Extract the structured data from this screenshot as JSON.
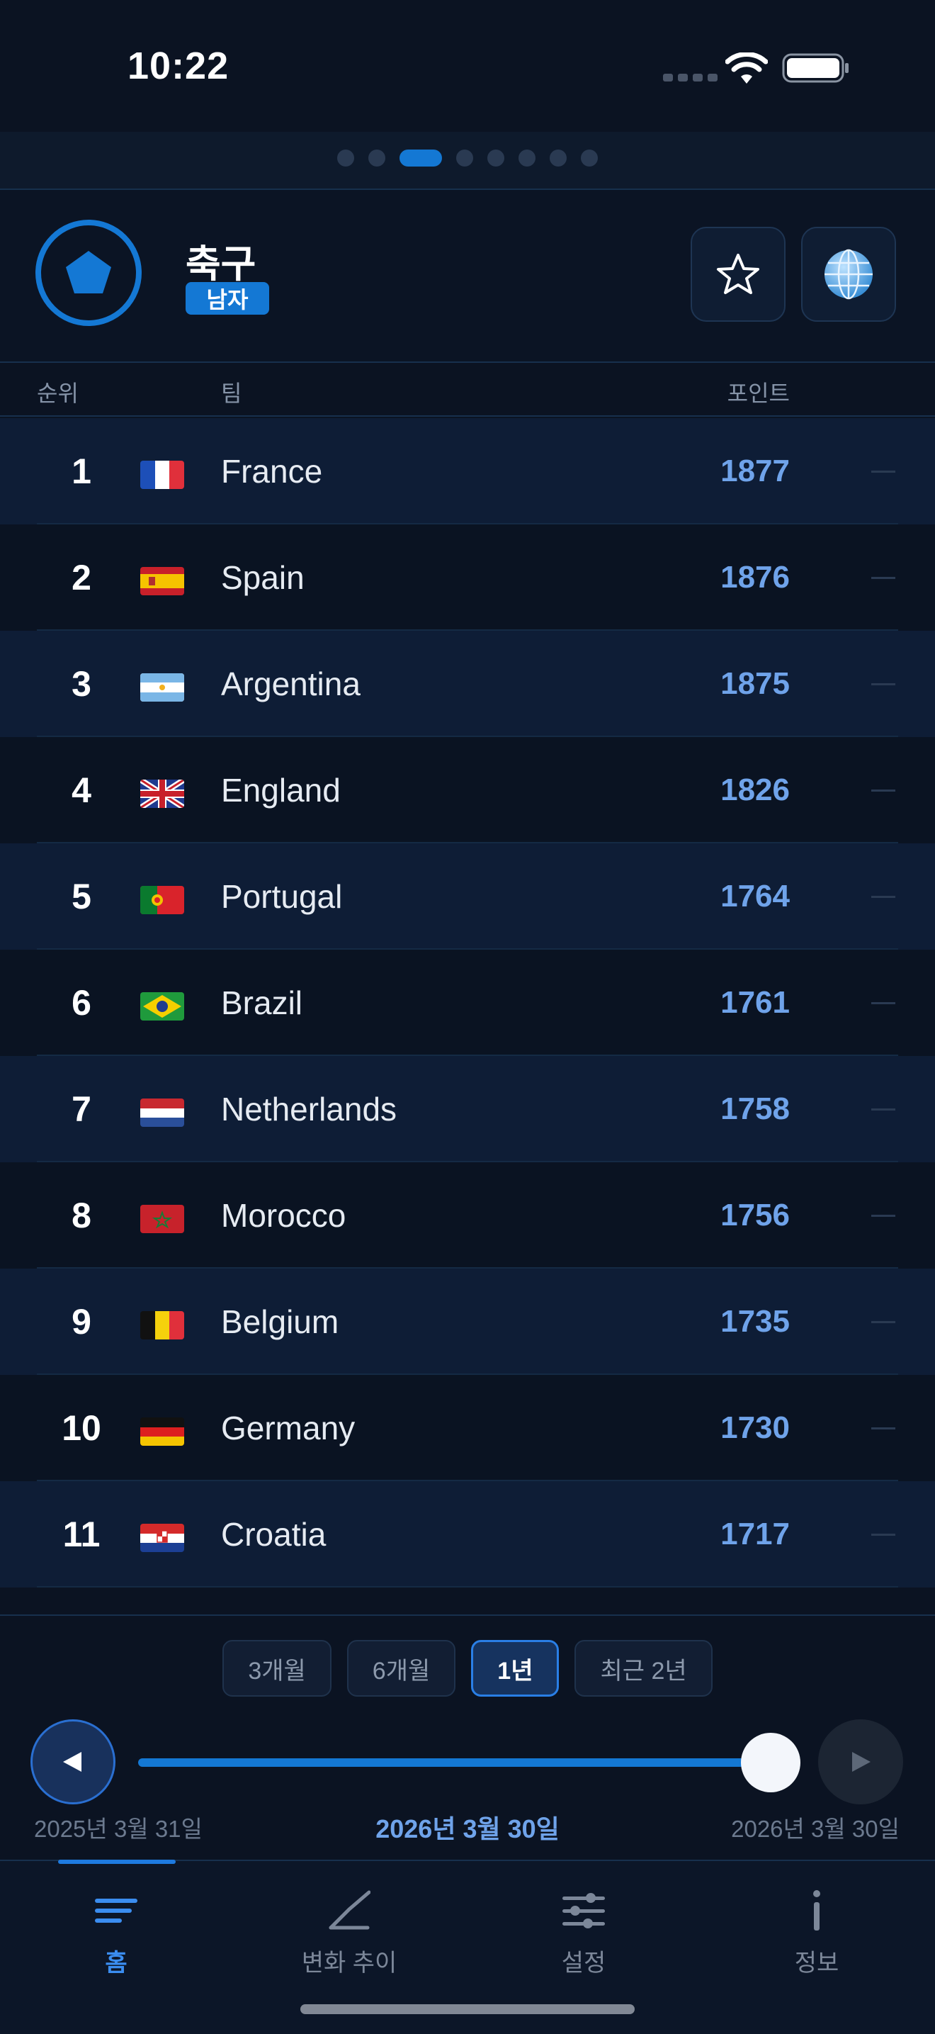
{
  "status_bar": {
    "time": "10:22"
  },
  "pager": {
    "count": 8,
    "active_index": 2
  },
  "header": {
    "sport": "축구",
    "gender": "남자",
    "logo_icon": "soccer-pentagon-icon",
    "favorite_icon": "star-outline-icon",
    "region_icon": "globe-icon"
  },
  "table": {
    "columns": {
      "rank": "순위",
      "team": "팀",
      "points": "포인트"
    },
    "rows": [
      {
        "rank": "1",
        "team": "France",
        "points": "1877",
        "flag": "france-flag-icon"
      },
      {
        "rank": "2",
        "team": "Spain",
        "points": "1876",
        "flag": "spain-flag-icon"
      },
      {
        "rank": "3",
        "team": "Argentina",
        "points": "1875",
        "flag": "argentina-flag-icon"
      },
      {
        "rank": "4",
        "team": "England",
        "points": "1826",
        "flag": "uk-flag-icon"
      },
      {
        "rank": "5",
        "team": "Portugal",
        "points": "1764",
        "flag": "portugal-flag-icon"
      },
      {
        "rank": "6",
        "team": "Brazil",
        "points": "1761",
        "flag": "brazil-flag-icon"
      },
      {
        "rank": "7",
        "team": "Netherlands",
        "points": "1758",
        "flag": "netherlands-flag-icon"
      },
      {
        "rank": "8",
        "team": "Morocco",
        "points": "1756",
        "flag": "morocco-flag-icon"
      },
      {
        "rank": "9",
        "team": "Belgium",
        "points": "1735",
        "flag": "belgium-flag-icon"
      },
      {
        "rank": "10",
        "team": "Germany",
        "points": "1730",
        "flag": "germany-flag-icon"
      },
      {
        "rank": "11",
        "team": "Croatia",
        "points": "1717",
        "flag": "croatia-flag-icon"
      }
    ]
  },
  "timeline": {
    "ranges": [
      "3개월",
      "6개월",
      "1년",
      "최근 2년"
    ],
    "selected_range": "1년",
    "start_date": "2025년 3월 31일",
    "current_date": "2026년 3월 30일",
    "end_date": "2026년 3월 30일",
    "slider_position": 1.0
  },
  "tabs": [
    {
      "label": "홈",
      "icon": "home-list-icon",
      "active": true
    },
    {
      "label": "변화 추이",
      "icon": "trend-line-icon",
      "active": false
    },
    {
      "label": "설정",
      "icon": "sliders-icon",
      "active": false
    },
    {
      "label": "정보",
      "icon": "info-icon",
      "active": false
    }
  ],
  "colors": {
    "accent": "#1478d4",
    "points": "#6fa3ea",
    "background": "#0b1322"
  }
}
